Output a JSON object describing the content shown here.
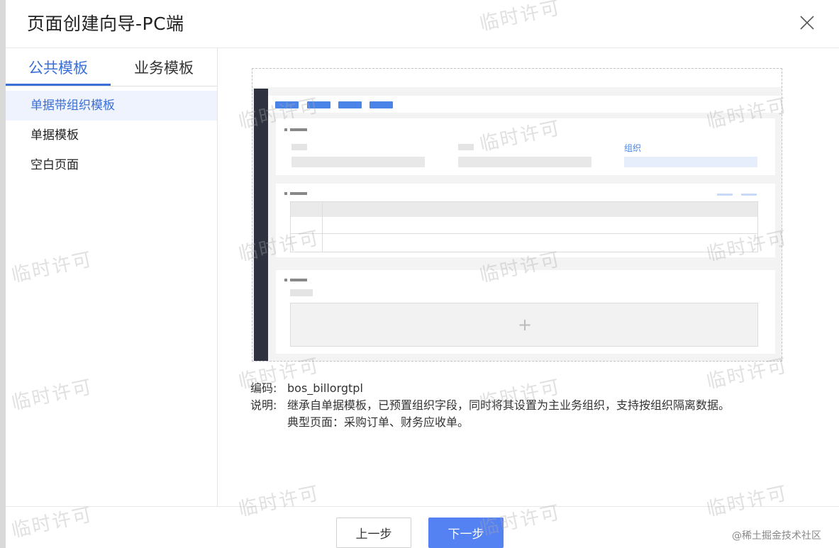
{
  "dialog": {
    "title": "页面创建向导-PC端"
  },
  "tabs": [
    {
      "label": "公共模板",
      "active": true
    },
    {
      "label": "业务模板",
      "active": false
    }
  ],
  "templates": [
    {
      "label": "单据带组织模板",
      "selected": true
    },
    {
      "label": "单据模板",
      "selected": false
    },
    {
      "label": "空白页面",
      "selected": false
    }
  ],
  "preview": {
    "org_label": "组织",
    "plus": "+"
  },
  "info": {
    "code_label": "编码:",
    "code_value": "bos_billorgtpl",
    "desc_label": "说明:",
    "desc_line1": "继承自单据模板，已预置组织字段，同时将其设置为主业务组织，支持按组织隔离数据。",
    "desc_line2": "典型页面：采购订单、财务应收单。"
  },
  "footer": {
    "prev_label": "上一步",
    "next_label": "下一步"
  },
  "watermark": "临时许可",
  "credit": "@稀土掘金技术社区",
  "colors": {
    "accent": "#3a6fd8",
    "primary_button": "#5582f3",
    "selected_bg": "#eef3fd"
  },
  "icons": {
    "close": "close-icon"
  }
}
